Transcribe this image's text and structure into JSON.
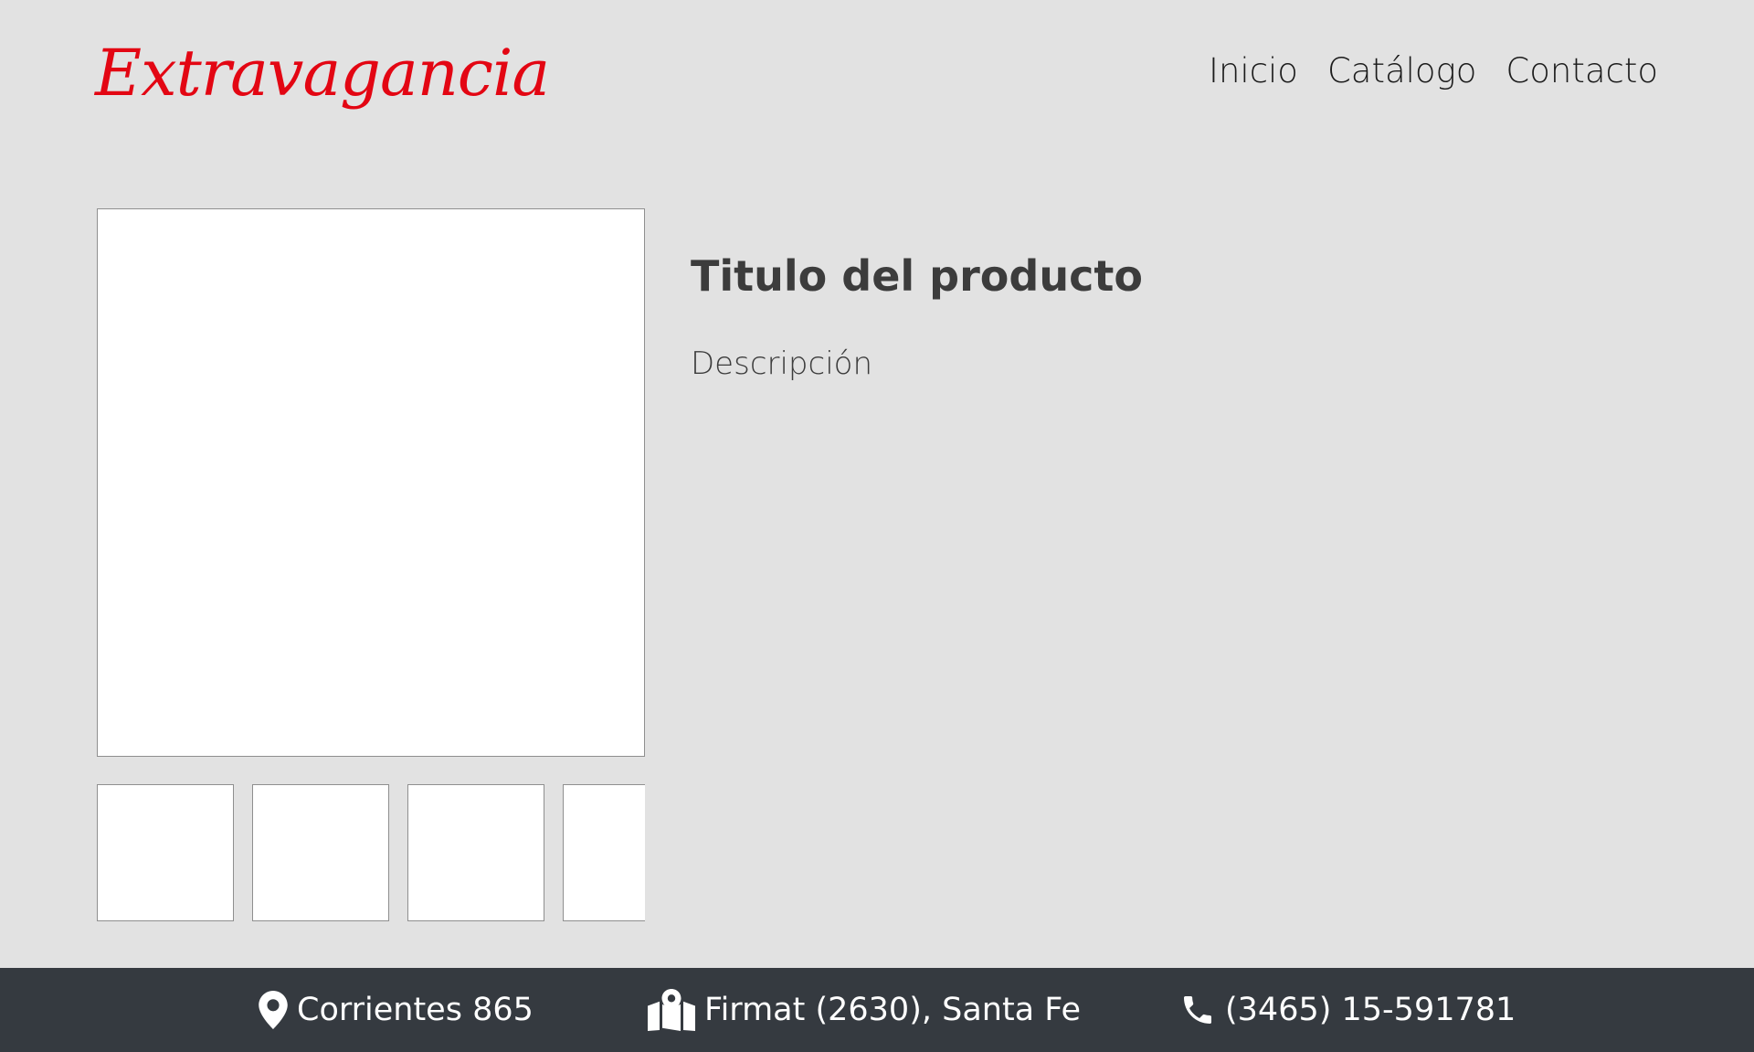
{
  "brand": {
    "name": "Extravagancia",
    "color": "#e30613"
  },
  "nav": {
    "items": [
      {
        "label": "Inicio"
      },
      {
        "label": "Catálogo"
      },
      {
        "label": "Contacto"
      }
    ]
  },
  "gallery": {
    "main_image_icon": "product-image-placeholder",
    "thumbnail_icon": "product-thumbnail-placeholder"
  },
  "product": {
    "title": "Titulo del producto",
    "description": "Descripción"
  },
  "footer": {
    "background": "#353a40",
    "address": {
      "icon": "map-marker-icon",
      "text": "Corrientes 865"
    },
    "city": {
      "icon": "map-icon",
      "text": "Firmat (2630), Santa Fe"
    },
    "phone": {
      "icon": "phone-icon",
      "text": "(3465) 15-591781"
    }
  }
}
